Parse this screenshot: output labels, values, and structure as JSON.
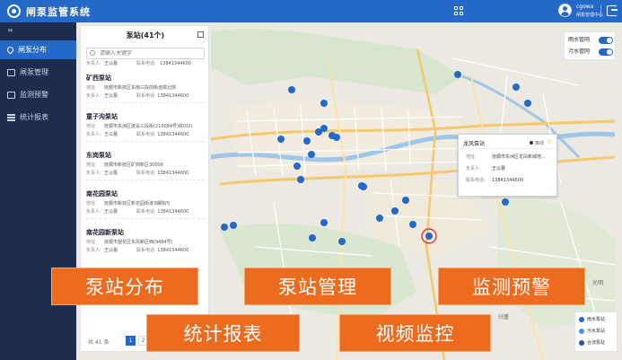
{
  "header": {
    "app_title": "闸泵监管系统",
    "user_name": "cgowa",
    "user_dept": "闸泵管理中心"
  },
  "sidebar": {
    "items": [
      {
        "label": "闸泵分布",
        "icon": "pin-icon",
        "active": true
      },
      {
        "label": "闸泵管理",
        "icon": "gear-icon",
        "active": false
      },
      {
        "label": "监测预警",
        "icon": "bell-icon",
        "active": false
      },
      {
        "label": "统计报表",
        "icon": "chart-icon",
        "active": false
      }
    ]
  },
  "list_panel": {
    "title": "泵站(41个)",
    "search_placeholder": "请输入关键字",
    "first_row": {
      "k1": "负责人:",
      "v1": "王以蕾",
      "k2": "联系电话:",
      "v2": "13841344600"
    },
    "stations": [
      {
        "name": "矿西泵站",
        "address": "抚顺市新抚区东南三段前街道院北侧",
        "person": "王以蕾",
        "phone": "13841344600"
      },
      {
        "name": "童子沟泵站",
        "address": "抚顺市东洲区建设三段街(210094号)院(02)",
        "person": "王以蕾",
        "phone": "13841344600"
      },
      {
        "name": "东岗泵站",
        "address": "抚顺市新抚区矿岗新区30006",
        "person": "王以蕾",
        "phone": "13841344600"
      },
      {
        "name": "南花园泵站",
        "address": "抚顺市新抚区新花园街道3期院内",
        "person": "王以蕾",
        "phone": "13841344600"
      },
      {
        "name": "南花园新泵站",
        "address": "抚顺市望花区东风新区西(9494号)",
        "person": "王以蕾",
        "phone": "13841344600"
      }
    ],
    "labels": {
      "address": "地址:",
      "person": "负责人:",
      "phone": "联系电话:"
    },
    "pager": {
      "total": "共 41 条",
      "pages": [
        "1",
        "2"
      ],
      "current": "1"
    }
  },
  "layers": [
    {
      "label": "雨水管网",
      "on": true
    },
    {
      "label": "污水管网",
      "on": true
    }
  ],
  "popup": {
    "title": "龙凤泵站",
    "status": "离线",
    "rows": [
      {
        "k": "地址:",
        "v": "抚顺市东洲区龙凤新城地..."
      },
      {
        "k": "负责人:",
        "v": "王以蕾"
      },
      {
        "k": "联系电话:",
        "v": "13841344600"
      }
    ]
  },
  "legend": [
    {
      "label": "雨水泵站",
      "color": "#2468c8"
    },
    {
      "label": "污水泵站",
      "color": "#4a8fe0"
    },
    {
      "label": "合流泵站",
      "color": "#2c4fa8"
    }
  ],
  "map_labels": [
    "光明",
    "兴盛"
  ],
  "features": [
    "泵站分布",
    "泵站管理",
    "监测预警",
    "统计报表",
    "视频监控"
  ],
  "colors": {
    "brand": "#2468c8",
    "sidebar": "#1e2d4d",
    "feature": "#ed6b1f"
  }
}
